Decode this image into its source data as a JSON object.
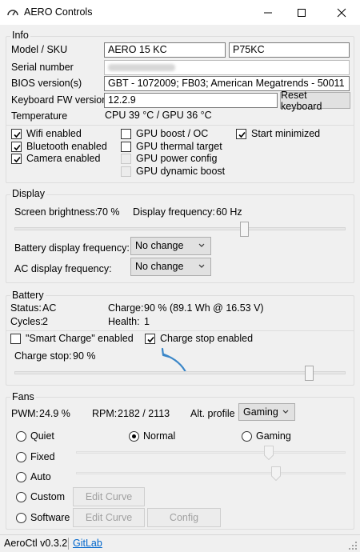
{
  "window": {
    "title": "AERO Controls",
    "icon": "gauge-icon"
  },
  "info": {
    "legend": "Info",
    "model_label": "Model / SKU",
    "model_value": "AERO 15 KC",
    "sku_value": "P75KC",
    "serial_label": "Serial number",
    "bios_label": "BIOS version(s)",
    "bios_value": "GBT    - 1072009; FB03; American Megatrends - 50011",
    "kbfw_label": "Keyboard FW version",
    "kbfw_value": "12.2.9",
    "reset_keyboard": "Reset keyboard",
    "temperature_label": "Temperature",
    "temperature_value": "CPU  39 °C  /  GPU  36 °C",
    "checkboxes": [
      {
        "label": "Wifi enabled",
        "checked": true,
        "enabled": true
      },
      {
        "label": "Bluetooth enabled",
        "checked": true,
        "enabled": true
      },
      {
        "label": "Camera enabled",
        "checked": true,
        "enabled": true
      },
      {
        "label": "GPU boost / OC",
        "checked": false,
        "enabled": true
      },
      {
        "label": "GPU thermal target",
        "checked": false,
        "enabled": true
      },
      {
        "label": "GPU power config",
        "checked": false,
        "enabled": false
      },
      {
        "label": "GPU dynamic boost",
        "checked": false,
        "enabled": false
      },
      {
        "label": "Start minimized",
        "checked": true,
        "enabled": true
      }
    ]
  },
  "display": {
    "legend": "Display",
    "brightness_label": "Screen brightness:",
    "brightness_value": "70 %",
    "brightness_level": 0.7,
    "frequency_label": "Display frequency:",
    "frequency_value": "60 Hz",
    "battery_freq_label": "Battery display frequency:",
    "battery_freq_value": "No change",
    "ac_freq_label": "AC display frequency:",
    "ac_freq_value": "No change"
  },
  "battery": {
    "legend": "Battery",
    "status_label": "Status:",
    "status_value": "AC",
    "charge_label": "Charge:",
    "charge_value": "90 % (89.1 Wh @ 16.53 V)",
    "cycles_label": "Cycles:",
    "cycles_value": "2",
    "health_label": "Health:",
    "health_value": "1",
    "smart_charge_label": "\"Smart Charge\" enabled",
    "smart_charge_checked": false,
    "charge_stop_enabled_label": "Charge stop enabled",
    "charge_stop_enabled_checked": true,
    "charge_stop_label": "Charge stop:",
    "charge_stop_value": "90 %",
    "charge_stop_level": 0.9,
    "annotation_color": "#3a86c8"
  },
  "fans": {
    "legend": "Fans",
    "pwm_label": "PWM:",
    "pwm_value": "24.9 %",
    "rpm_label": "RPM:",
    "rpm_value": "2182  /  2113",
    "alt_profile_label": "Alt. profile",
    "alt_profile_value": "Gaming",
    "modes": [
      "Quiet",
      "Normal",
      "Gaming",
      "Fixed",
      "Auto",
      "Custom",
      "Software"
    ],
    "selected_mode": "Normal",
    "edit_curve": "Edit Curve",
    "config": "Config"
  },
  "statusbar": {
    "version": "AeroCtl v0.3.2",
    "link": "GitLab"
  }
}
